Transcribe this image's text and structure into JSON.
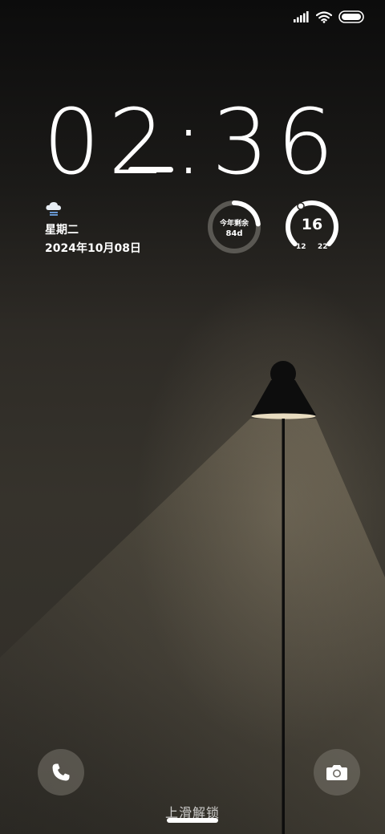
{
  "clock": {
    "time": "02:36"
  },
  "date_widget": {
    "weather_icon": "rain-cloud-icon",
    "weekday": "星期二",
    "date": "2024年10月08日"
  },
  "year_widget": {
    "label": "今年剩余",
    "value": "84d",
    "progress_fraction": 0.23
  },
  "temp_widget": {
    "current": "16",
    "low": "12",
    "high": "22",
    "progress_fraction": 0.4
  },
  "status_bar": {
    "icons": [
      "signal-icon",
      "wifi-icon",
      "battery-icon"
    ]
  },
  "bottom": {
    "unlock_text": "上滑解锁",
    "left_icon": "phone-icon",
    "right_icon": "camera-icon"
  },
  "colors": {
    "ring_track": "#5a5853",
    "ring_fill": "#ffffff",
    "button_bg": "#77736c"
  }
}
